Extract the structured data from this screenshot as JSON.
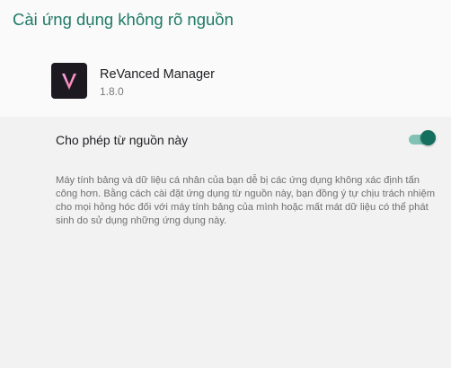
{
  "header": {
    "title": "Cài ứng dụng không rõ nguồn"
  },
  "app": {
    "name": "ReVanced Manager",
    "version": "1.8.0",
    "icon": "revanced-logo"
  },
  "setting": {
    "label": "Cho phép từ nguồn này",
    "enabled": true
  },
  "warning": {
    "text": "Máy tính bảng và dữ liệu cá nhân của bạn dễ bị các ứng dụng không xác định tấn công hơn. Bằng cách cài đặt ứng dụng từ nguồn này, bạn đồng ý tự chịu trách nhiệm cho mọi hỏng hóc đối với máy tính bảng của mình hoặc mất mát dữ liệu có thể phát sinh do sử dụng những ứng dụng này."
  },
  "colors": {
    "accent": "#1f7a66",
    "toggle_thumb": "#146f5e",
    "toggle_track": "#80c2b3",
    "icon_background": "#1c1a20"
  }
}
